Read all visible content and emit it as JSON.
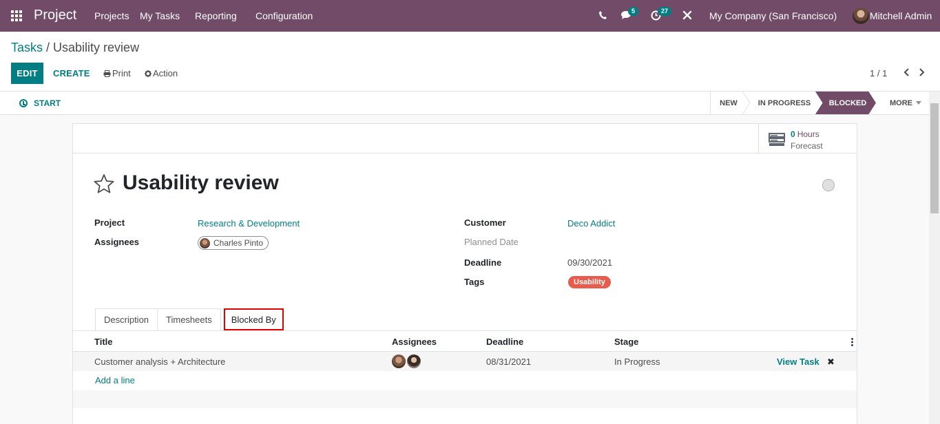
{
  "navbar": {
    "app_name": "Project",
    "menus": [
      "Projects",
      "My Tasks",
      "Reporting",
      "Configuration"
    ],
    "chat_badge": "5",
    "activity_badge": "27",
    "company": "My Company (San Francisco)",
    "user": "Mitchell Admin",
    "brand_color": "#714b67"
  },
  "breadcrumb": {
    "parent": "Tasks",
    "separator": " / ",
    "current": "Usability review"
  },
  "toolbar": {
    "edit_label": "EDIT",
    "create_label": "CREATE",
    "print_label": "Print",
    "action_label": "Action",
    "pager_value": "1 / 1"
  },
  "statusbar": {
    "start_label": "START",
    "stages": [
      {
        "label": "NEW",
        "active": false
      },
      {
        "label": "IN PROGRESS",
        "active": false
      },
      {
        "label": "BLOCKED",
        "active": true
      },
      {
        "label": "MORE",
        "active": false
      }
    ]
  },
  "stat_button": {
    "value": "0",
    "unit": "Hours",
    "label": "Forecast"
  },
  "task": {
    "title": "Usability review",
    "fields_left": {
      "project_label": "Project",
      "project_value": "Research & Development",
      "assignees_label": "Assignees",
      "assignee_value": "Charles Pinto"
    },
    "fields_right": {
      "customer_label": "Customer",
      "customer_value": "Deco Addict",
      "planned_date_label": "Planned Date",
      "deadline_label": "Deadline",
      "deadline_value": "09/30/2021",
      "tags_label": "Tags",
      "tag_value": "Usability"
    }
  },
  "tabs": [
    {
      "label": "Description",
      "active": false
    },
    {
      "label": "Timesheets",
      "active": false
    },
    {
      "label": "Blocked By",
      "active": true
    }
  ],
  "blocked_by": {
    "columns": [
      "Title",
      "Assignees",
      "Deadline",
      "Stage"
    ],
    "rows": [
      {
        "title": "Customer analysis + Architecture",
        "deadline": "08/31/2021",
        "stage": "In Progress",
        "view_label": "View Task"
      }
    ],
    "add_line_label": "Add a line"
  },
  "colors": {
    "accent": "#017e84",
    "brand": "#714b67",
    "tag_usability": "#e85b4d",
    "highlight": "#e00000"
  }
}
